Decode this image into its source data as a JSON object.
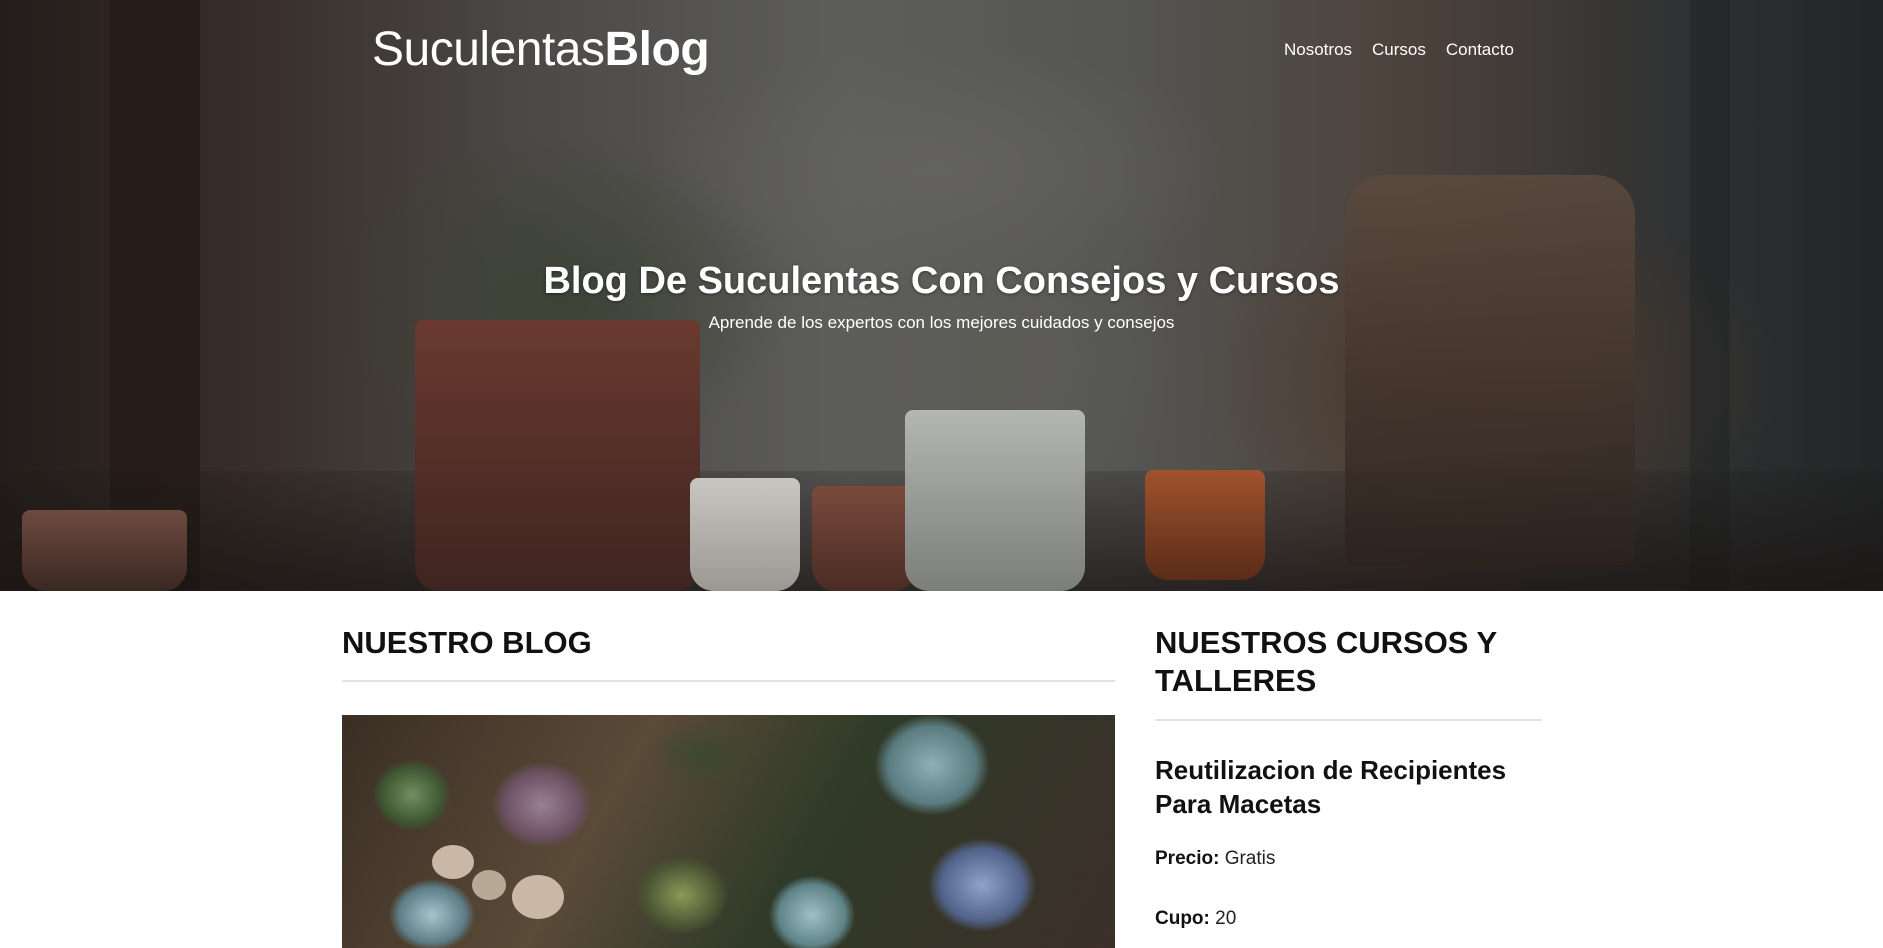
{
  "header": {
    "brand_light": "Suculentas",
    "brand_bold": "Blog",
    "nav": [
      "Nosotros",
      "Cursos",
      "Contacto"
    ]
  },
  "hero": {
    "title": "Blog De Suculentas Con Consejos y Cursos",
    "subtitle": "Aprende de los expertos con los mejores cuidados y consejos"
  },
  "blog": {
    "heading": "NUESTRO BLOG"
  },
  "courses": {
    "heading": "NUESTROS CURSOS Y TALLERES",
    "items": [
      {
        "title": "Reutilizacion de Recipientes Para Macetas",
        "price_label": "Precio:",
        "price_value": "Gratis",
        "capacity_label": "Cupo:",
        "capacity_value": "20"
      }
    ]
  }
}
